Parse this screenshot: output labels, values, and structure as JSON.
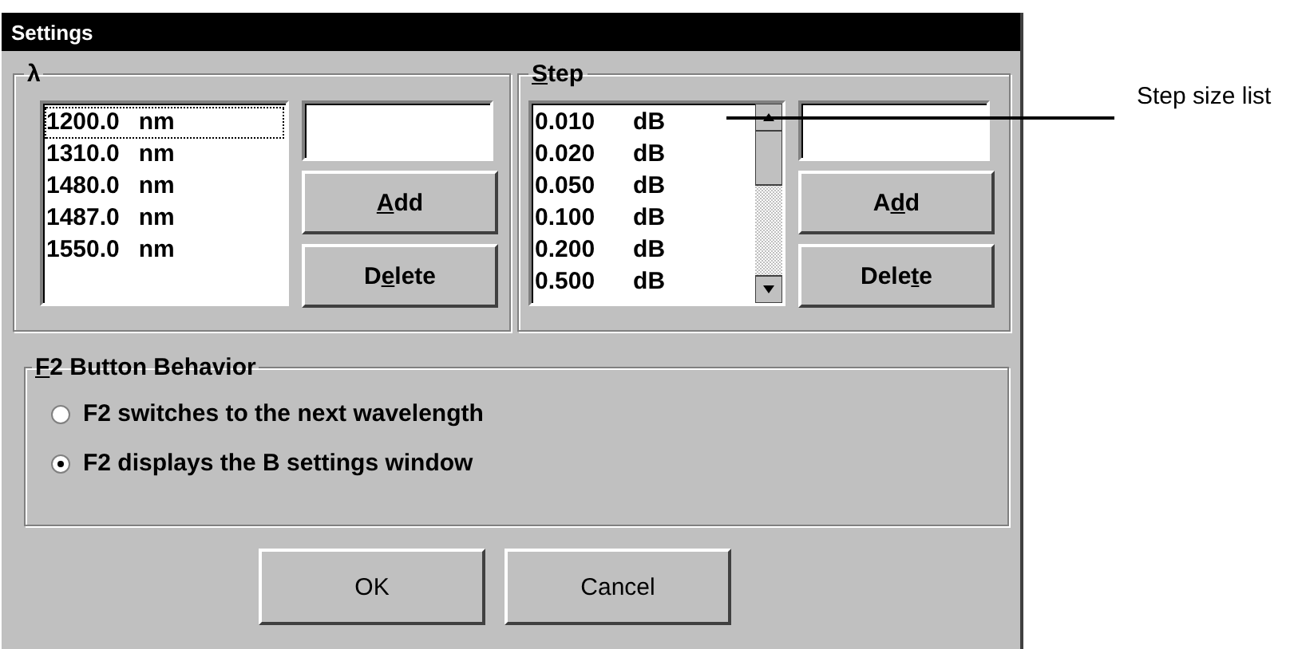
{
  "window": {
    "title": "Settings"
  },
  "wavelength_group": {
    "label": "λ",
    "list": [
      {
        "value": "1200.0",
        "unit": "nm",
        "focused": true
      },
      {
        "value": "1310.0",
        "unit": "nm",
        "focused": false
      },
      {
        "value": "1480.0",
        "unit": "nm",
        "focused": false
      },
      {
        "value": "1487.0",
        "unit": "nm",
        "focused": false
      },
      {
        "value": "1550.0",
        "unit": "nm",
        "focused": false
      }
    ],
    "buttons": [
      {
        "key": "A",
        "post": "dd"
      },
      {
        "pre": "D",
        "key": "e",
        "post": "lete"
      }
    ]
  },
  "step_group": {
    "label": {
      "key": "S",
      "post": "tep"
    },
    "list": [
      {
        "value": "0.010",
        "unit": "dB",
        "focused": false
      },
      {
        "value": "0.020",
        "unit": "dB",
        "focused": false
      },
      {
        "value": "0.050",
        "unit": "dB",
        "focused": false
      },
      {
        "value": "0.100",
        "unit": "dB",
        "focused": false
      },
      {
        "value": "0.200",
        "unit": "dB",
        "focused": false
      },
      {
        "value": "0.500",
        "unit": "dB",
        "focused": false
      }
    ],
    "buttons": [
      {
        "pre": "A",
        "key": "d",
        "post": "d"
      },
      {
        "pre": "Dele",
        "key": "t",
        "post": "e"
      }
    ]
  },
  "f2_group": {
    "label": {
      "key": "F",
      "post": "2 Button Behavior"
    },
    "options": [
      {
        "label": "F2 switches to the next wavelength",
        "selected": false
      },
      {
        "label": "F2 displays the B settings window",
        "selected": true
      }
    ]
  },
  "buttons": [
    "OK",
    "Cancel"
  ],
  "callout": {
    "text": "Step size list"
  }
}
